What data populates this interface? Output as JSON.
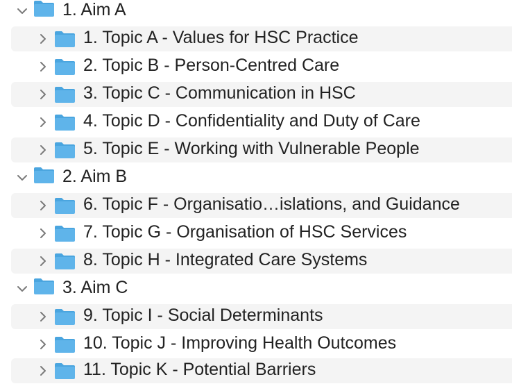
{
  "colors": {
    "folder_body": "#5fb4ea",
    "folder_tab": "#4aa5df",
    "row_stripe": "#f4f4f4",
    "chevron": "#7a7a7a",
    "text": "#222222"
  },
  "icons": {
    "expanded": "chevron-down-icon",
    "collapsed": "chevron-right-icon",
    "folder": "folder-icon"
  },
  "tree": [
    {
      "label": "1. Aim A",
      "expanded": true,
      "children": [
        {
          "label": "1. Topic A - Values for HSC Practice"
        },
        {
          "label": "2. Topic B - Person-Centred Care"
        },
        {
          "label": "3. Topic C - Communication in HSC"
        },
        {
          "label": "4. Topic D - Confidentiality and Duty of Care"
        },
        {
          "label": "5. Topic E - Working with Vulnerable People"
        }
      ]
    },
    {
      "label": "2. Aim B",
      "expanded": true,
      "children": [
        {
          "label": "6. Topic F - Organisatio…islations, and Guidance"
        },
        {
          "label": "7. Topic G - Organisation of HSC Services"
        },
        {
          "label": "8. Topic H - Integrated Care Systems"
        }
      ]
    },
    {
      "label": "3. Aim C",
      "expanded": true,
      "children": [
        {
          "label": "9. Topic I - Social Determinants"
        },
        {
          "label": "10. Topic J - Improving Health Outcomes"
        },
        {
          "label": "11. Topic K - Potential Barriers"
        }
      ]
    }
  ]
}
